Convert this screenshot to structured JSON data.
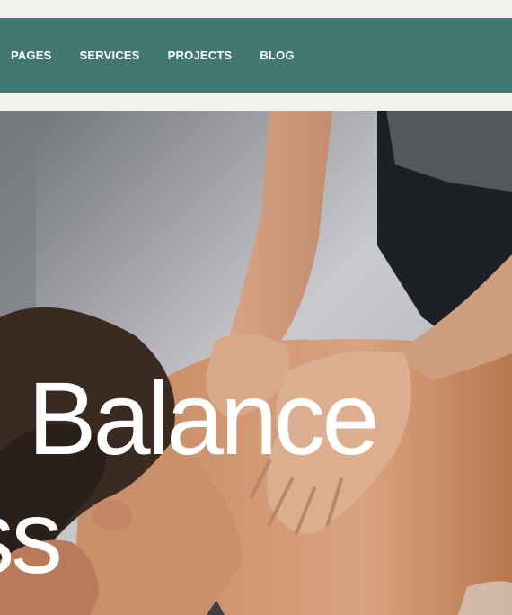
{
  "nav": {
    "items": [
      {
        "label": "PAGES"
      },
      {
        "label": "SERVICES"
      },
      {
        "label": "PROJECTS"
      },
      {
        "label": "BLOG"
      }
    ]
  },
  "hero": {
    "title_line1": "g Balance",
    "title_line2": "ness"
  },
  "colors": {
    "nav_background": "#427872",
    "page_background": "#f3f1ee",
    "hero_text": "#ffffff"
  }
}
